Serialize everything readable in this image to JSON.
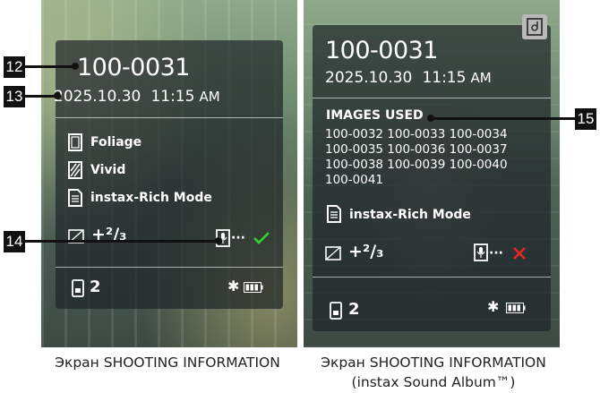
{
  "left_screen": {
    "frame_number": "100-0031",
    "date": "2025.10.30",
    "time": "11:15",
    "ampm": "AM",
    "film_simulation": "Foliage",
    "color_setting": "Vivid",
    "print_mode": "instax-Rich Mode",
    "exposure_comp": "+²/₃",
    "print_count": "2",
    "audio_status": "check"
  },
  "right_screen": {
    "frame_number": "100-0031",
    "date": "2025.10.30",
    "time": "11:15",
    "ampm": "AM",
    "images_used_label": "IMAGES USED",
    "images_used": [
      "100-0032 100-0033 100-0034",
      "100-0035 100-0036 100-0037",
      "100-0038 100-0039 100-0040",
      "100-0041"
    ],
    "print_mode": "instax-Rich Mode",
    "exposure_comp": "+²/₃",
    "print_count": "2",
    "audio_status": "cross"
  },
  "callouts": [
    "12",
    "13",
    "14",
    "15"
  ],
  "captions": {
    "left": "Экран SHOOTING INFORMATION",
    "right_line1": "Экран SHOOTING INFORMATION",
    "right_line2": "(instax Sound Album™)"
  },
  "colors": {
    "check": "#2fd62f",
    "cross": "#e8262a"
  }
}
